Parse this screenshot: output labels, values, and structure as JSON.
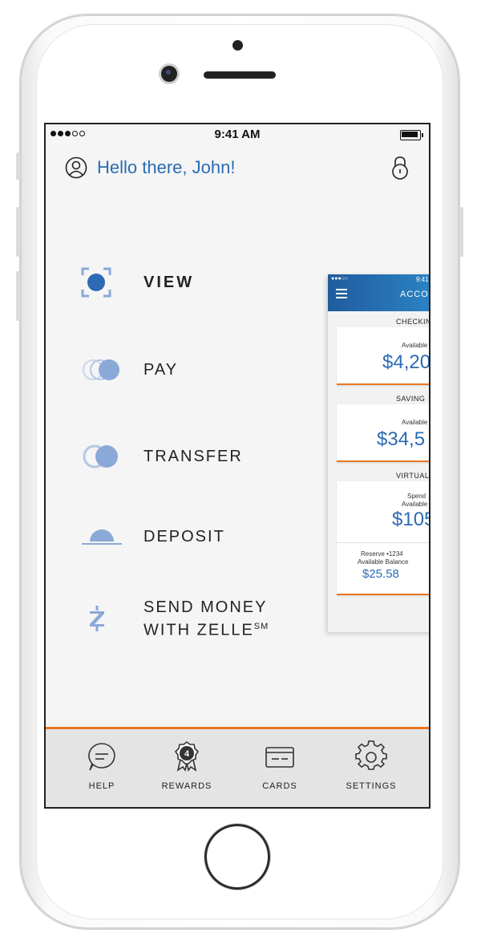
{
  "status": {
    "time": "9:41 AM"
  },
  "header": {
    "greeting": "Hello there, John!"
  },
  "menu": {
    "view": "VIEW",
    "pay": "PAY",
    "transfer": "TRANSFER",
    "deposit": "DEPOSIT",
    "send_line1": "SEND MONEY",
    "send_line2": "WITH ZELLE",
    "send_sup": "SM"
  },
  "preview": {
    "time": "9:41",
    "title": "ACCO",
    "checking": {
      "section": "CHECKIN",
      "label": "Available",
      "amount": "$4,20"
    },
    "savings": {
      "section": "SAVING",
      "label": "Available",
      "amount": "$34,5"
    },
    "virtual": {
      "section": "VIRTUAL",
      "label1": "Spend",
      "label2": "Available",
      "amount": "$105",
      "reserve_label": "Reserve •1234",
      "reserve_sub": "Available Balance",
      "reserve_amount": "$25.58"
    }
  },
  "tabs": {
    "help": "HELP",
    "rewards": "REWARDS",
    "rewards_badge": "4",
    "cards": "CARDS",
    "settings": "SETTINGS"
  },
  "colors": {
    "accent": "#2c6bb3",
    "orange": "#e87722",
    "icon_light": "#9eb5dc"
  }
}
